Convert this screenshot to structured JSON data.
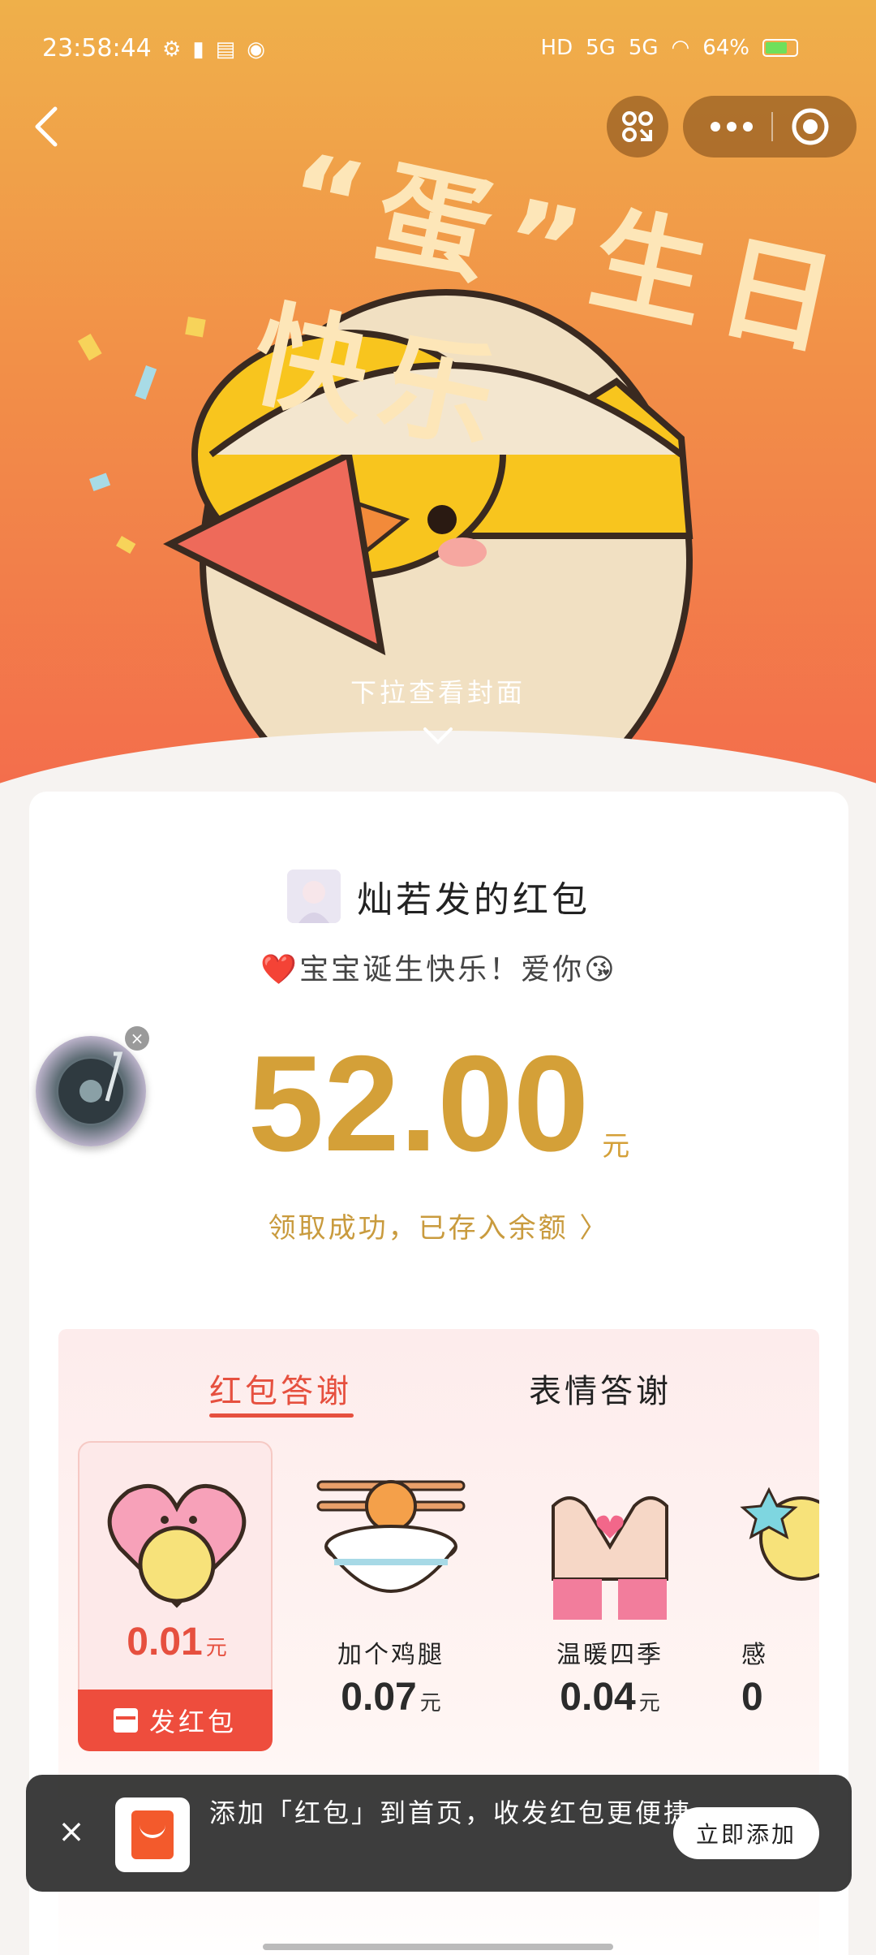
{
  "status_bar": {
    "time": "23:58:44",
    "battery_percent": "64%",
    "network_1": "5G",
    "network_2": "5G",
    "hd_label": "HD"
  },
  "hero": {
    "title": "“蛋”生日快乐",
    "pull_hint": "下拉查看封面"
  },
  "card": {
    "sender": "灿若发的红包",
    "greeting": "❤️宝宝诞生快乐！爱你😘",
    "amount": "52.00",
    "unit": "元",
    "received_text": "领取成功，已存入余额 〉"
  },
  "thanks": {
    "tabs": [
      {
        "label": "红包答谢"
      },
      {
        "label": "表情答谢"
      }
    ],
    "gifts": [
      {
        "label": "",
        "price": "0.01",
        "unit": "元",
        "selected": true,
        "button_label": "发红包"
      },
      {
        "label": "加个鸡腿",
        "price": "0.07",
        "unit": "元"
      },
      {
        "label": "温暖四季",
        "price": "0.04",
        "unit": "元"
      },
      {
        "label": "感",
        "price": "0",
        "unit": ""
      }
    ]
  },
  "banner": {
    "text": "添加「红包」到首页，收发红包更便捷",
    "button_label": "立即添加"
  },
  "colors": {
    "accent_red": "#ee4d3d",
    "gold": "#d4a038"
  }
}
